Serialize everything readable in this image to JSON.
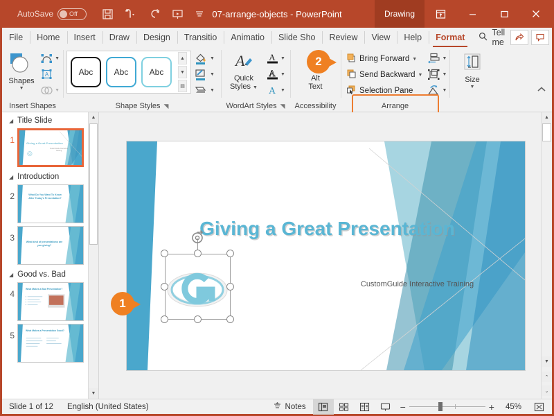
{
  "titlebar": {
    "autosave_label": "AutoSave",
    "autosave_state": "Off",
    "document_title": "07-arrange-objects  -  PowerPoint",
    "contextual_tab": "Drawing",
    "qat": [
      "save-icon",
      "undo-icon",
      "redo-icon",
      "start-presentation-icon",
      "customize-qat-icon"
    ],
    "window_buttons": [
      "ribbon-display-options",
      "minimize",
      "maximize",
      "close"
    ]
  },
  "tabs": {
    "items": [
      {
        "label": "File",
        "active": false
      },
      {
        "label": "Home",
        "active": false
      },
      {
        "label": "Insert",
        "active": false
      },
      {
        "label": "Draw",
        "active": false
      },
      {
        "label": "Design",
        "active": false
      },
      {
        "label": "Transitio",
        "active": false
      },
      {
        "label": "Animatio",
        "active": false
      },
      {
        "label": "Slide Sho",
        "active": false
      },
      {
        "label": "Review",
        "active": false
      },
      {
        "label": "View",
        "active": false
      },
      {
        "label": "Help",
        "active": false
      },
      {
        "label": "Format",
        "active": true
      }
    ],
    "tell_me": "Tell me",
    "right_buttons": [
      "share-icon",
      "comments-icon"
    ]
  },
  "ribbon": {
    "groups": [
      {
        "name": "Insert Shapes",
        "label": "Insert Shapes"
      },
      {
        "name": "Shape Styles",
        "label": "Shape Styles"
      },
      {
        "name": "WordArt Styles",
        "label": "WordArt Styles"
      },
      {
        "name": "Accessibility",
        "label": "Accessibility"
      },
      {
        "name": "Arrange",
        "label": "Arrange"
      },
      {
        "name": "Size",
        "label": "Size"
      }
    ],
    "insert_shapes": {
      "shapes_label": "Shapes",
      "icons": [
        "edit-shape-icon",
        "text-box-icon",
        "merge-shapes-icon"
      ]
    },
    "shape_styles": {
      "gallery": [
        "Abc",
        "Abc",
        "Abc"
      ],
      "side_icons": [
        "shape-fill-icon",
        "shape-outline-icon",
        "shape-effects-icon"
      ]
    },
    "wordart_styles": {
      "quick_styles_label": "Quick Styles",
      "side_icons": [
        "text-fill-icon",
        "text-outline-icon",
        "text-effects-icon"
      ]
    },
    "accessibility": {
      "alt_text_label": "Alt Text"
    },
    "arrange": {
      "bring_forward": "Bring Forward",
      "send_backward": "Send Backward",
      "selection_pane": "Selection Pane",
      "side_icons": [
        "align-icon",
        "group-icon",
        "rotate-icon"
      ]
    },
    "size": {
      "label": "Size"
    },
    "collapse_label": "collapse-ribbon-icon"
  },
  "callouts": [
    {
      "number": "1",
      "target": "selected-logo-object"
    },
    {
      "number": "2",
      "target": "arrange-order-buttons"
    }
  ],
  "thumbnails": {
    "sections": [
      {
        "title": "Title Slide",
        "slides": [
          {
            "number": "1",
            "selected": true,
            "kind": "title",
            "title": "Giving a Great Presentation",
            "sub": "CustomGuide Interactive Training"
          }
        ]
      },
      {
        "title": "Introduction",
        "slides": [
          {
            "number": "2",
            "selected": false,
            "kind": "text",
            "title": "What Do You Want To Know After Today's Presentation?",
            "sub": ""
          },
          {
            "number": "3",
            "selected": false,
            "kind": "text",
            "title": "What kind of presentations are you giving?",
            "sub": ""
          }
        ]
      },
      {
        "title": "Good vs. Bad",
        "slides": [
          {
            "number": "4",
            "selected": false,
            "kind": "bullets-image",
            "title": "What Makes a Bad Presentation?",
            "sub": ""
          },
          {
            "number": "5",
            "selected": false,
            "kind": "bullets-two",
            "title": "What Makes a Presentation Good?",
            "sub": ""
          }
        ]
      }
    ]
  },
  "slide": {
    "title": "Giving a Great Presentation",
    "subtitle": "CustomGuide Interactive Training",
    "selected_object": "customguide-logo",
    "theme_colors": {
      "accent_teal": "#5ab6d4",
      "accent_deep": "#2f93bd",
      "accent_dark": "#3a8fa8"
    }
  },
  "status": {
    "slide_counter": "Slide 1 of 12",
    "language": "English (United States)",
    "notes_label": "Notes",
    "views": [
      {
        "name": "normal-view",
        "active": true
      },
      {
        "name": "slide-sorter-view",
        "active": false
      },
      {
        "name": "reading-view",
        "active": false
      },
      {
        "name": "slide-show-view",
        "active": false
      }
    ],
    "zoom_out": "−",
    "zoom_in": "+",
    "zoom_level": "45%",
    "fit_to_window": "fit-slide-to-window-icon"
  }
}
